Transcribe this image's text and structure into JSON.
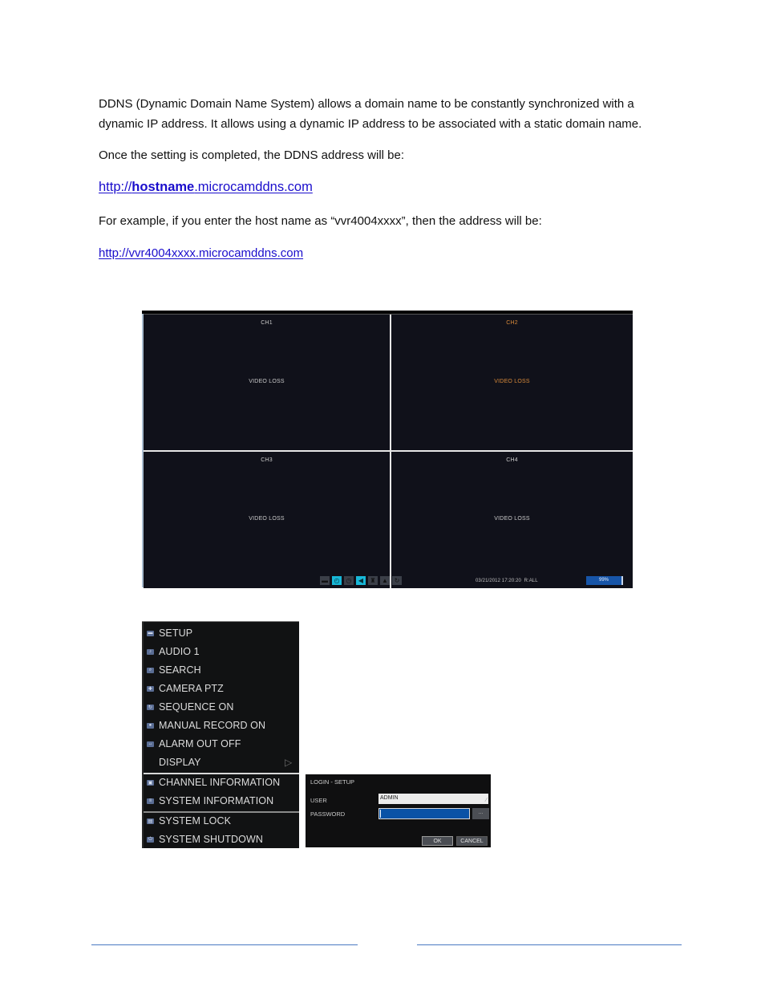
{
  "text": {
    "intro_line1": "DDNS (Dynamic Domain Name System) allows a domain name to be constantly synchronized with a",
    "intro_line2": "dynamic IP address. It allows using a dynamic IP address to be associated with a static domain name.",
    "once": "Once the setting is completed, the DDNS address will be:",
    "example": "For example, if you enter the host name as “vvr4004xxxx”, then the address will be:"
  },
  "links": {
    "template_prefix": "http://",
    "template_host": "hostname",
    "template_suffix": ".microcamddns.com",
    "example_url": "http://vvr4004xxxx.microcamddns.com"
  },
  "dvr": {
    "channels": [
      {
        "name": "CH1",
        "status": "VIDEO LOSS",
        "active": false
      },
      {
        "name": "CH2",
        "status": "VIDEO LOSS",
        "active": true
      },
      {
        "name": "CH3",
        "status": "VIDEO LOSS",
        "active": false
      },
      {
        "name": "CH4",
        "status": "VIDEO LOSS",
        "active": false
      }
    ],
    "status_icons": [
      {
        "name": "network-icon",
        "glyph": "▬",
        "on": false
      },
      {
        "name": "record-timer-icon",
        "glyph": "◴",
        "on": true
      },
      {
        "name": "schedule-clock-icon",
        "glyph": "◷",
        "on": false
      },
      {
        "name": "audio-speaker-icon",
        "glyph": "◀",
        "on": true
      },
      {
        "name": "alarm-icon",
        "glyph": "♜",
        "on": false
      },
      {
        "name": "hdd-icon",
        "glyph": "▲",
        "on": false
      },
      {
        "name": "overwrite-icon",
        "glyph": "↻",
        "on": false
      }
    ],
    "datetime": "03/21/2012 17:20:20",
    "record_mode": "R:ALL",
    "hdd_percent_label": "99%",
    "hdd_fraction": 0.99,
    "active_color": "#d98a3a"
  },
  "menu": {
    "items": [
      {
        "label": "SETUP",
        "icon": "setup-icon",
        "glyph": "▬"
      },
      {
        "label": "AUDIO 1",
        "icon": "audio-icon",
        "glyph": "♪"
      },
      {
        "label": "SEARCH",
        "icon": "search-icon",
        "glyph": "⌕"
      },
      {
        "label": "CAMERA PTZ",
        "icon": "ptz-icon",
        "glyph": "✚"
      },
      {
        "label": "SEQUENCE ON",
        "icon": "sequence-icon",
        "glyph": "↻"
      },
      {
        "label": "MANUAL RECORD ON",
        "icon": "record-icon",
        "glyph": "●"
      },
      {
        "label": "ALARM OUT OFF",
        "icon": "alarm-out-icon",
        "glyph": "↔"
      },
      {
        "label": "DISPLAY",
        "icon": "",
        "glyph": "",
        "submenu_arrow": "▷"
      },
      {
        "label": "CHANNEL INFORMATION",
        "icon": "channel-info-icon",
        "glyph": "▣"
      },
      {
        "label": "SYSTEM INFORMATION",
        "icon": "system-info-icon",
        "glyph": "≡"
      },
      {
        "label": "SYSTEM LOCK",
        "icon": "lock-icon",
        "glyph": "▤"
      },
      {
        "label": "SYSTEM SHUTDOWN",
        "icon": "power-icon",
        "glyph": "⏻"
      }
    ]
  },
  "login": {
    "title": "LOGIN - SETUP",
    "user_label": "USER",
    "user_value": "ADMIN",
    "password_label": "PASSWORD",
    "password_value": "",
    "more_button": "...",
    "ok": "OK",
    "cancel": "CANCEL"
  }
}
